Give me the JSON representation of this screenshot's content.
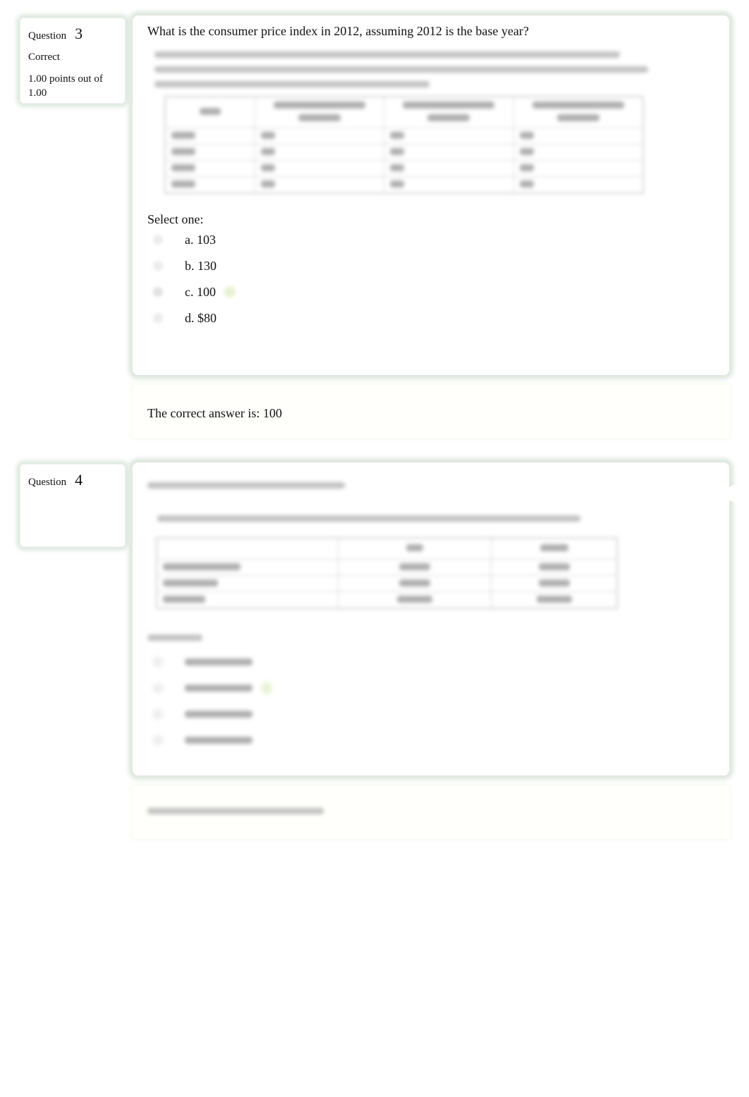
{
  "questions": [
    {
      "label": "Question",
      "number": "3",
      "state": "Correct",
      "grade": "1.00 points out of 1.00",
      "text": "What is the consumer price index in 2012, assuming 2012 is the base year?",
      "prompt": "Select one:",
      "options": [
        {
          "label": "a. 103",
          "selected": false
        },
        {
          "label": "b. 130",
          "selected": false
        },
        {
          "label": "c. 100",
          "selected": true,
          "correct": true
        },
        {
          "label": "d. $80",
          "selected": false
        }
      ],
      "feedback": "The correct answer is: 100",
      "obscured_content": true
    },
    {
      "label": "Question",
      "number": "4",
      "state": "",
      "grade": "",
      "obscured_content": true,
      "options_count": 4
    }
  ],
  "colors": {
    "panel_glow": "#dae6dc",
    "check_highlight": "#e4ecc8",
    "feedback_bg": "#fffffc"
  }
}
